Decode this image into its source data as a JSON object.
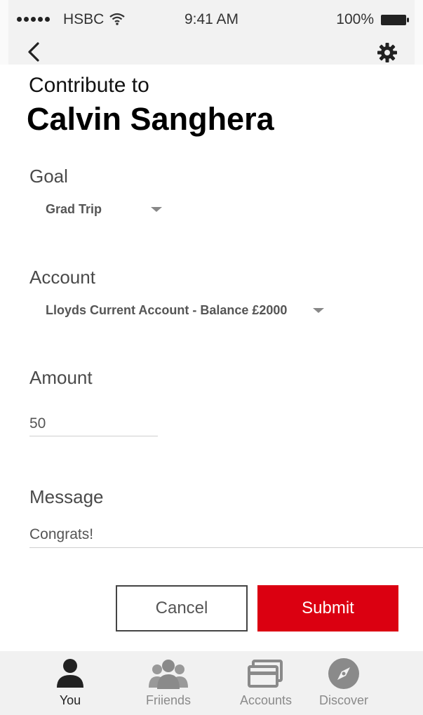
{
  "status_bar": {
    "carrier": "HSBC",
    "time": "9:41 AM",
    "battery": "100%"
  },
  "header": {
    "subtitle": "Contribute to",
    "title": "Calvin Sanghera"
  },
  "form": {
    "goal": {
      "label": "Goal",
      "value": "Grad Trip"
    },
    "account": {
      "label": "Account",
      "value": "Lloyds Current Account - Balance £2000"
    },
    "amount": {
      "label": "Amount",
      "value": "50"
    },
    "message": {
      "label": "Message",
      "value": "Congrats!"
    }
  },
  "actions": {
    "cancel": "Cancel",
    "submit": "Submit"
  },
  "tabs": [
    {
      "label": "You",
      "icon": "person-icon",
      "active": true
    },
    {
      "label": "Friiends",
      "icon": "people-icon",
      "active": false
    },
    {
      "label": "Accounts",
      "icon": "cards-icon",
      "active": false
    },
    {
      "label": "Discover",
      "icon": "compass-icon",
      "active": false
    }
  ],
  "colors": {
    "accent": "#db0011",
    "active_tab": "#222222",
    "inactive_tab": "#8a8a8a"
  }
}
